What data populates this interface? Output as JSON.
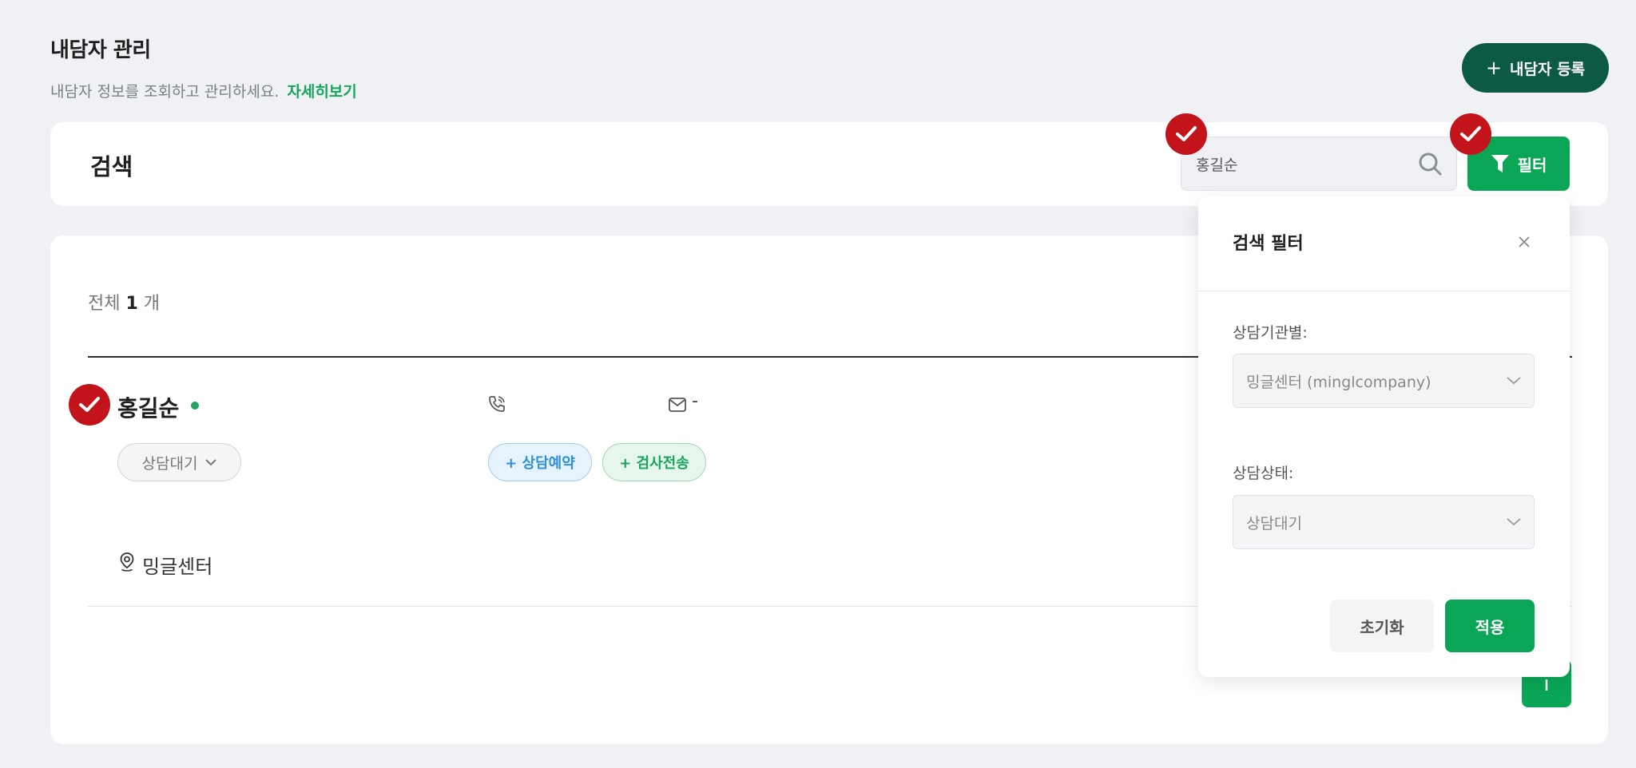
{
  "header": {
    "title": "내담자 관리",
    "description": "내담자 정보를 조회하고 관리하세요.",
    "more_link": "자세히보기",
    "register_label": "내담자 등록",
    "register_plus": "+"
  },
  "search": {
    "label": "검색",
    "value": "홍길순",
    "filter_label": "필터"
  },
  "list": {
    "total_prefix": "전체",
    "total_count": "1",
    "total_suffix": "개",
    "items": [
      {
        "name": "홍길순",
        "status": "상담대기",
        "email": "-",
        "reserve_label": "+ 상담예약",
        "send_label": "+ 검사전송",
        "center": "밍글센터"
      }
    ]
  },
  "filter_panel": {
    "title": "검색 필터",
    "org_label": "상담기관별:",
    "org_value": "밍글센터 (minglcompany)",
    "status_label": "상담상태:",
    "status_value": "상담대기",
    "reset_label": "초기화",
    "apply_label": "적용"
  },
  "colors": {
    "primary_green": "#0aa655",
    "dark_green": "#0c5a45",
    "badge_red": "#c4141b",
    "background": "#f0f1f4"
  }
}
